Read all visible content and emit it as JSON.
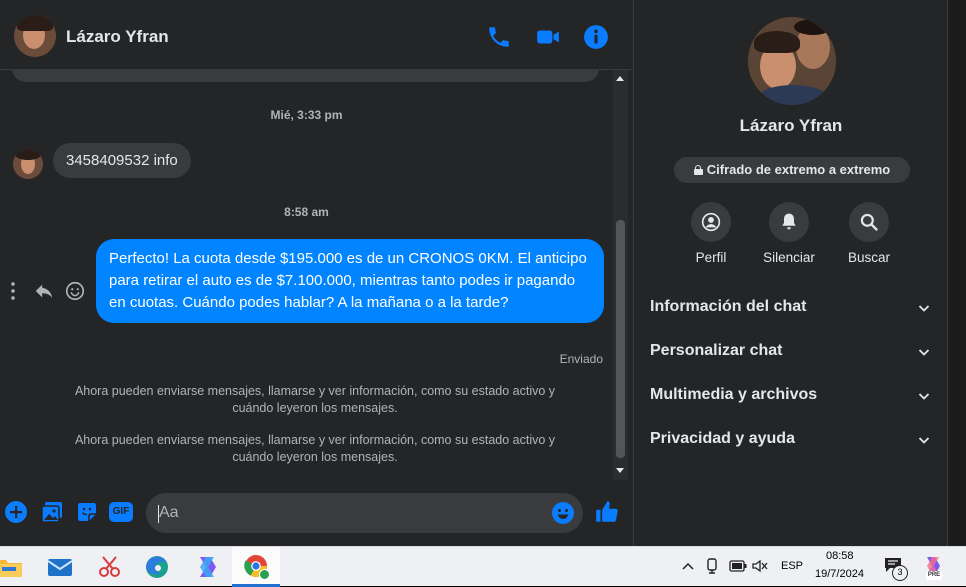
{
  "header": {
    "contact_name": "Lázaro Yfran",
    "icons": [
      "phone-icon",
      "video-icon",
      "info-icon"
    ]
  },
  "messages": {
    "timestamp_1": "Mié, 3:33 pm",
    "incoming_text": "3458409532 info",
    "timestamp_2": "8:58 am",
    "outgoing_text": "Perfecto! La cuota desde $195.000 es de un CRONOS 0KM. El anticipo para retirar el auto es de $7.100.000, mientras tanto podes ir pagando en cuotas. Cuándo podes hablar? A la mañana o a la tarde?",
    "status": "Enviado",
    "notice_1": "Ahora pueden enviarse mensajes, llamarse y ver información, como su estado activo y cuándo leyeron los mensajes.",
    "notice_2": "Ahora pueden enviarse mensajes, llamarse y ver información, como su estado activo y cuándo leyeron los mensajes."
  },
  "composer": {
    "placeholder": "Aa",
    "gif_label": "GIF"
  },
  "right_panel": {
    "name": "Lázaro Yfran",
    "encryption_label": "Cifrado de extremo a extremo",
    "actions": [
      {
        "label": "Perfil",
        "icon": "profile-icon"
      },
      {
        "label": "Silenciar",
        "icon": "bell-icon"
      },
      {
        "label": "Buscar",
        "icon": "search-icon"
      }
    ],
    "sections": [
      {
        "label": "Información del chat"
      },
      {
        "label": "Personalizar chat"
      },
      {
        "label": "Multimedia y archivos"
      },
      {
        "label": "Privacidad y ayuda"
      }
    ]
  },
  "taskbar": {
    "language": "ESP",
    "time": "08:58",
    "date": "19/7/2024",
    "notification_count": "3",
    "copilot_badge": "PRE"
  },
  "colors": {
    "accent": "#0084ff",
    "background": "#242526",
    "bubble_in": "#3a3b3c"
  }
}
